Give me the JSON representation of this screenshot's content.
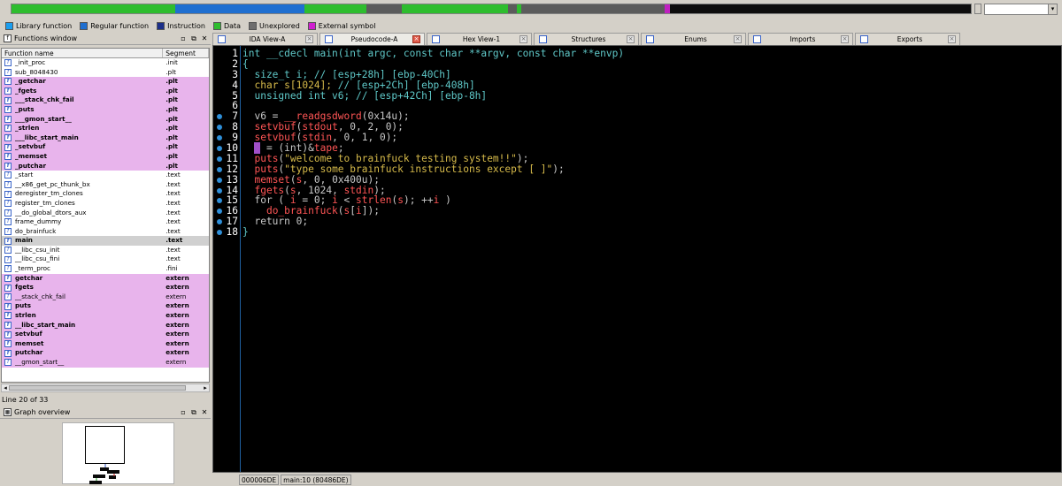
{
  "navbar": {
    "segments": [
      {
        "color": "#2ebd2e",
        "w": 185
      },
      {
        "color": "#1f6fd0",
        "w": 147
      },
      {
        "color": "#2ebd2e",
        "w": 70
      },
      {
        "color": "#5b5b5b",
        "w": 40
      },
      {
        "color": "#2ebd2e",
        "w": 120
      },
      {
        "color": "#5b5b5b",
        "w": 10
      },
      {
        "color": "#2ebd2e",
        "w": 5
      },
      {
        "color": "#5b5b5b",
        "w": 162
      },
      {
        "color": "#c020c0",
        "w": 6
      },
      {
        "color": "#0d0d0d",
        "w": 341
      }
    ]
  },
  "legend": [
    {
      "label": "Library function",
      "color": "#1a9ef0"
    },
    {
      "label": "Regular function",
      "color": "#1f6fd0"
    },
    {
      "label": "Instruction",
      "color": "#1c2f8a"
    },
    {
      "label": "Data",
      "color": "#2ebd2e"
    },
    {
      "label": "Unexplored",
      "color": "#6e6e6e"
    },
    {
      "label": "External symbol",
      "color": "#d020d0"
    }
  ],
  "functions_window": {
    "title": "Functions window",
    "col_name": "Function name",
    "col_segment": "Segment",
    "status": "Line 20 of 33",
    "rows": [
      {
        "name": "_init_proc",
        "segment": ".init",
        "style": ""
      },
      {
        "name": "sub_8048430",
        "segment": ".plt",
        "style": ""
      },
      {
        "name": "_getchar",
        "segment": ".plt",
        "style": "lib"
      },
      {
        "name": "_fgets",
        "segment": ".plt",
        "style": "lib"
      },
      {
        "name": "___stack_chk_fail",
        "segment": ".plt",
        "style": "lib"
      },
      {
        "name": "_puts",
        "segment": ".plt",
        "style": "lib"
      },
      {
        "name": "___gmon_start__",
        "segment": ".plt",
        "style": "lib"
      },
      {
        "name": "_strlen",
        "segment": ".plt",
        "style": "lib"
      },
      {
        "name": "___libc_start_main",
        "segment": ".plt",
        "style": "lib"
      },
      {
        "name": "_setvbuf",
        "segment": ".plt",
        "style": "lib"
      },
      {
        "name": "_memset",
        "segment": ".plt",
        "style": "lib"
      },
      {
        "name": "_putchar",
        "segment": ".plt",
        "style": "lib"
      },
      {
        "name": "_start",
        "segment": ".text",
        "style": ""
      },
      {
        "name": "__x86_get_pc_thunk_bx",
        "segment": ".text",
        "style": ""
      },
      {
        "name": "deregister_tm_clones",
        "segment": ".text",
        "style": ""
      },
      {
        "name": "register_tm_clones",
        "segment": ".text",
        "style": ""
      },
      {
        "name": "__do_global_dtors_aux",
        "segment": ".text",
        "style": ""
      },
      {
        "name": "frame_dummy",
        "segment": ".text",
        "style": ""
      },
      {
        "name": "do_brainfuck",
        "segment": ".text",
        "style": ""
      },
      {
        "name": "main",
        "segment": ".text",
        "style": "sel"
      },
      {
        "name": "__libc_csu_init",
        "segment": ".text",
        "style": ""
      },
      {
        "name": "__libc_csu_fini",
        "segment": ".text",
        "style": ""
      },
      {
        "name": "_term_proc",
        "segment": ".fini",
        "style": ""
      },
      {
        "name": "getchar",
        "segment": "extern",
        "style": "lib"
      },
      {
        "name": "fgets",
        "segment": "extern",
        "style": "lib"
      },
      {
        "name": "__stack_chk_fail",
        "segment": "extern",
        "style": "ext"
      },
      {
        "name": "puts",
        "segment": "extern",
        "style": "lib"
      },
      {
        "name": "strlen",
        "segment": "extern",
        "style": "lib"
      },
      {
        "name": "__libc_start_main",
        "segment": "extern",
        "style": "lib"
      },
      {
        "name": "setvbuf",
        "segment": "extern",
        "style": "lib"
      },
      {
        "name": "memset",
        "segment": "extern",
        "style": "lib"
      },
      {
        "name": "putchar",
        "segment": "extern",
        "style": "lib"
      },
      {
        "name": "__gmon_start__",
        "segment": "extern",
        "style": "ext"
      }
    ]
  },
  "graph_overview": {
    "title": "Graph overview"
  },
  "tabs": [
    {
      "label": "IDA View-A",
      "active": false,
      "close_red": false
    },
    {
      "label": "Pseudocode-A",
      "active": true,
      "close_red": true
    },
    {
      "label": "Hex View-1",
      "active": false,
      "close_red": false
    },
    {
      "label": "Structures",
      "active": false,
      "close_red": false
    },
    {
      "label": "Enums",
      "active": false,
      "close_red": false
    },
    {
      "label": "Imports",
      "active": false,
      "close_red": false
    },
    {
      "label": "Exports",
      "active": false,
      "close_red": false
    }
  ],
  "code": [
    {
      "n": "1",
      "bp": false,
      "tokens": [
        [
          "int __cdecl main(int argc, const char **argv, const char **envp)",
          "p"
        ]
      ]
    },
    {
      "n": "2",
      "bp": false,
      "tokens": [
        [
          "{",
          "p"
        ]
      ]
    },
    {
      "n": "3",
      "bp": false,
      "tokens": [
        [
          "  size_t i; // [esp+28h] [ebp-40Ch]",
          "p"
        ]
      ]
    },
    {
      "n": "4",
      "bp": false,
      "tokens": [
        [
          "  ",
          "p"
        ],
        [
          "char s[1024];",
          "g"
        ],
        [
          " // [esp+2Ch] [ebp-408h]",
          "p"
        ]
      ]
    },
    {
      "n": "5",
      "bp": false,
      "tokens": [
        [
          "  unsigned int v6; // [esp+42Ch] [ebp-8h]",
          "p"
        ]
      ]
    },
    {
      "n": "6",
      "bp": false,
      "tokens": [
        [
          "",
          "p"
        ]
      ]
    },
    {
      "n": "7",
      "bp": true,
      "tokens": [
        [
          "  v6 = ",
          "v"
        ],
        [
          "__readgsdword",
          "f"
        ],
        [
          "(0x14u);",
          "v"
        ]
      ]
    },
    {
      "n": "8",
      "bp": true,
      "tokens": [
        [
          "  ",
          "p"
        ],
        [
          "setvbuf",
          "f"
        ],
        [
          "(",
          "v"
        ],
        [
          "stdout",
          "f"
        ],
        [
          ", 0, 2, 0);",
          "v"
        ]
      ]
    },
    {
      "n": "9",
      "bp": true,
      "tokens": [
        [
          "  ",
          "p"
        ],
        [
          "setvbuf",
          "f"
        ],
        [
          "(",
          "v"
        ],
        [
          "stdin",
          "f"
        ],
        [
          ", 0, 1, 0);",
          "v"
        ]
      ]
    },
    {
      "n": "10",
      "bp": true,
      "tokens": [
        [
          "  ",
          "p"
        ],
        [
          "p",
          "cur"
        ],
        [
          " = (int)&",
          "v"
        ],
        [
          "tape",
          "f"
        ],
        [
          ";",
          "v"
        ]
      ]
    },
    {
      "n": "11",
      "bp": true,
      "tokens": [
        [
          "  ",
          "p"
        ],
        [
          "puts",
          "f"
        ],
        [
          "(",
          "v"
        ],
        [
          "\"welcome to brainfuck testing system!!\"",
          "s"
        ],
        [
          ");",
          "v"
        ]
      ]
    },
    {
      "n": "12",
      "bp": true,
      "tokens": [
        [
          "  ",
          "p"
        ],
        [
          "puts",
          "f"
        ],
        [
          "(",
          "v"
        ],
        [
          "\"type some brainfuck instructions except [ ]\"",
          "s"
        ],
        [
          ");",
          "v"
        ]
      ]
    },
    {
      "n": "13",
      "bp": true,
      "tokens": [
        [
          "  ",
          "p"
        ],
        [
          "memset",
          "f"
        ],
        [
          "(",
          "v"
        ],
        [
          "s",
          "f"
        ],
        [
          ", 0, 0x400u);",
          "v"
        ]
      ]
    },
    {
      "n": "14",
      "bp": true,
      "tokens": [
        [
          "  ",
          "p"
        ],
        [
          "fgets",
          "f"
        ],
        [
          "(",
          "v"
        ],
        [
          "s",
          "f"
        ],
        [
          ", 1024, ",
          "v"
        ],
        [
          "stdin",
          "f"
        ],
        [
          ");",
          "v"
        ]
      ]
    },
    {
      "n": "15",
      "bp": true,
      "tokens": [
        [
          "  for ( ",
          "v"
        ],
        [
          "i",
          "f"
        ],
        [
          " = 0; ",
          "v"
        ],
        [
          "i",
          "f"
        ],
        [
          " < ",
          "v"
        ],
        [
          "strlen",
          "f"
        ],
        [
          "(",
          "v"
        ],
        [
          "s",
          "f"
        ],
        [
          "); ++",
          "v"
        ],
        [
          "i",
          "f"
        ],
        [
          " )",
          "v"
        ]
      ]
    },
    {
      "n": "16",
      "bp": true,
      "tokens": [
        [
          "    ",
          "p"
        ],
        [
          "do_brainfuck",
          "f"
        ],
        [
          "(",
          "v"
        ],
        [
          "s",
          "f"
        ],
        [
          "[",
          "v"
        ],
        [
          "i",
          "f"
        ],
        [
          "]);",
          "v"
        ]
      ]
    },
    {
      "n": "17",
      "bp": true,
      "tokens": [
        [
          "  return 0;",
          "v"
        ]
      ]
    },
    {
      "n": "18",
      "bp": true,
      "tokens": [
        [
          "}",
          "p"
        ]
      ]
    }
  ],
  "statusbar": {
    "address": "000006DE",
    "location": "main:10 (80486DE)"
  }
}
